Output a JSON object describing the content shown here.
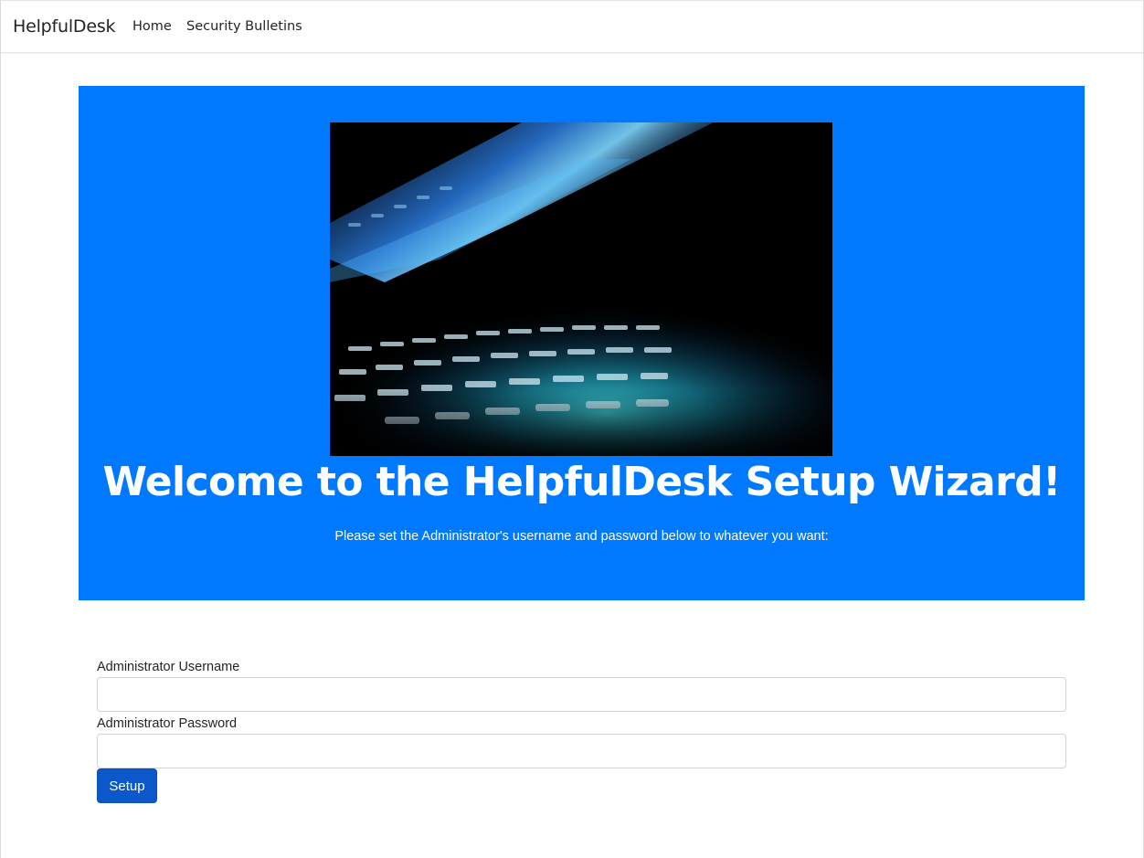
{
  "navbar": {
    "brand": "HelpfulDesk",
    "links": [
      {
        "label": "Home"
      },
      {
        "label": "Security Bulletins"
      }
    ]
  },
  "hero": {
    "background_color": "#0079ff",
    "image": "laptop-keyboard-photo",
    "title": "Welcome to the HelpfulDesk Setup Wizard!",
    "subtitle": "Please set the Administrator's username and password below to whatever you want:"
  },
  "form": {
    "username_label": "Administrator Username",
    "username_value": "",
    "password_label": "Administrator Password",
    "password_value": "",
    "submit_label": "Setup",
    "submit_color": "#0a58ca"
  }
}
